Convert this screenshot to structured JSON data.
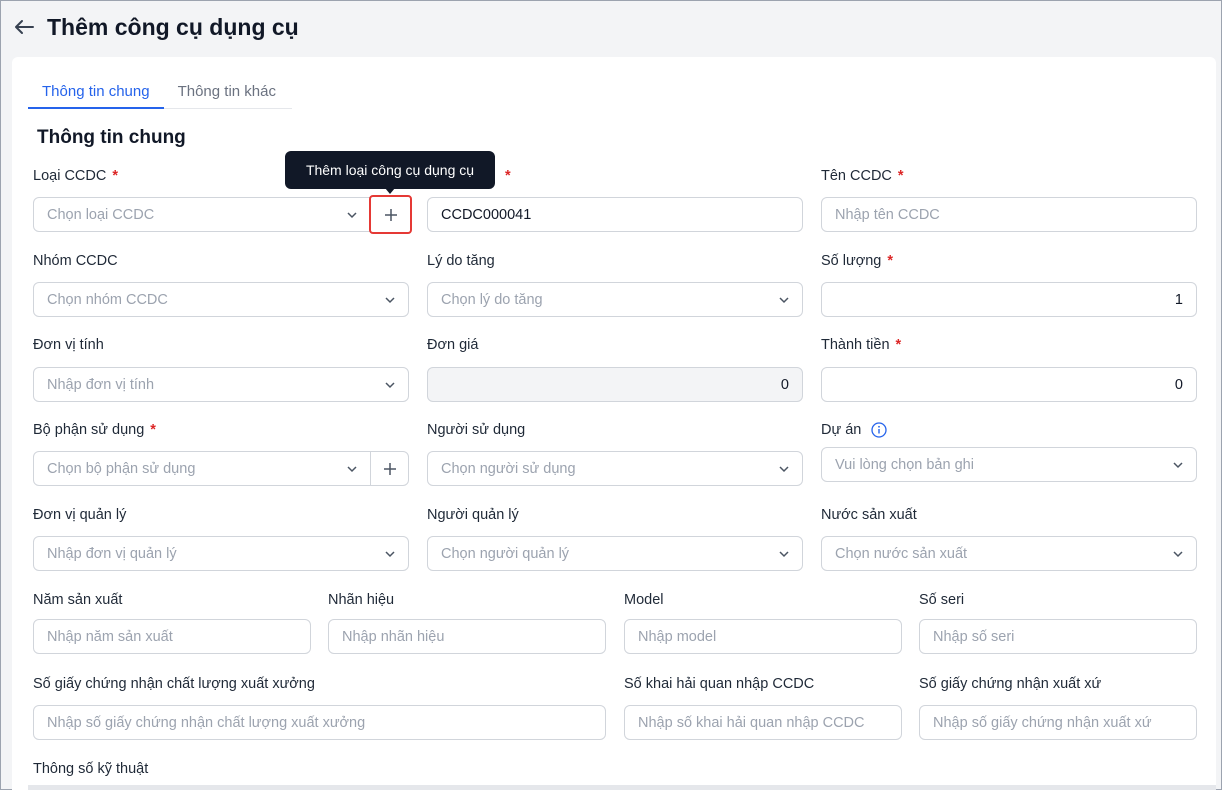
{
  "header": {
    "title": "Thêm công cụ dụng cụ"
  },
  "tabs": [
    {
      "label": "Thông tin chung",
      "active": true
    },
    {
      "label": "Thông tin khác",
      "active": false
    }
  ],
  "section_title": "Thông tin chung",
  "tooltip": "Thêm loại công cụ dụng cụ",
  "fields": {
    "loai_ccdc": {
      "label": "Loại CCDC",
      "placeholder": "Chọn loại CCDC"
    },
    "ma_ccdc": {
      "value": "CCDC000041"
    },
    "ten_ccdc": {
      "label": "Tên CCDC",
      "placeholder": "Nhập tên CCDC"
    },
    "nhom_ccdc": {
      "label": "Nhóm CCDC",
      "placeholder": "Chọn nhóm CCDC"
    },
    "ly_do_tang": {
      "label": "Lý do tăng",
      "placeholder": "Chọn lý do tăng"
    },
    "so_luong": {
      "label": "Số lượng",
      "value": "1"
    },
    "don_vi_tinh": {
      "label": "Đơn vị tính",
      "placeholder": "Nhập đơn vị tính"
    },
    "don_gia": {
      "label": "Đơn giá",
      "value": "0"
    },
    "thanh_tien": {
      "label": "Thành tiền",
      "value": "0"
    },
    "bo_phan_su_dung": {
      "label": "Bộ phận sử dụng",
      "placeholder": "Chọn bộ phận sử dụng"
    },
    "nguoi_su_dung": {
      "label": "Người sử dụng",
      "placeholder": "Chọn người sử dụng"
    },
    "du_an": {
      "label": "Dự án",
      "placeholder": "Vui lòng chọn bản ghi"
    },
    "don_vi_quan_ly": {
      "label": "Đơn vị quản lý",
      "placeholder": "Nhập đơn vị quản lý"
    },
    "nguoi_quan_ly": {
      "label": "Người quản lý",
      "placeholder": "Chọn người quản lý"
    },
    "nuoc_san_xuat": {
      "label": "Nước sản xuất",
      "placeholder": "Chọn nước sản xuất"
    },
    "nam_san_xuat": {
      "label": "Năm sản xuất",
      "placeholder": "Nhập năm sản xuất"
    },
    "nhan_hieu": {
      "label": "Nhãn hiệu",
      "placeholder": "Nhập nhãn hiệu"
    },
    "model": {
      "label": "Model",
      "placeholder": "Nhập model"
    },
    "so_seri": {
      "label": "Số seri",
      "placeholder": "Nhập số seri"
    },
    "so_gcn_clxx": {
      "label": "Số giấy chứng nhận chất lượng xuất xưởng",
      "placeholder": "Nhập số giấy chứng nhận chất lượng xuất xưởng"
    },
    "so_khai_hq": {
      "label": "Số khai hải quan nhập CCDC",
      "placeholder": "Nhập số khai hải quan nhập CCDC"
    },
    "so_gcn_xx": {
      "label": "Số giấy chứng nhận xuất xứ",
      "placeholder": "Nhập số giấy chứng nhận xuất xứ"
    },
    "thong_so_ky_thuat": {
      "label": "Thông số kỹ thuật"
    }
  },
  "colors": {
    "accent": "#2563eb",
    "required": "#dc2626",
    "highlight": "#e53935"
  }
}
